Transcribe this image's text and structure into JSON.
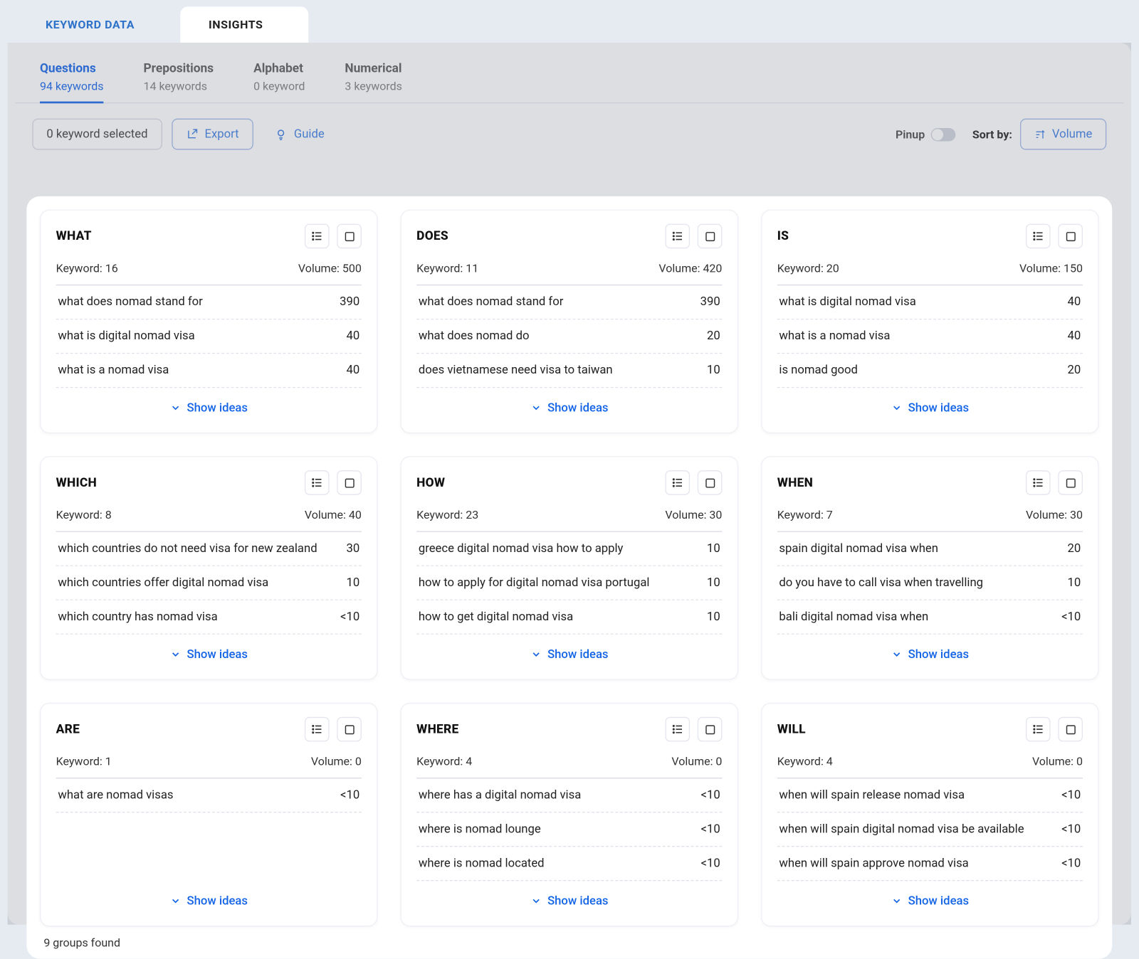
{
  "top_tabs": {
    "keyword_data": "KEYWORD DATA",
    "insights": "INSIGHTS"
  },
  "sub_tabs": [
    {
      "label": "Questions",
      "count": "94 keywords",
      "active": true
    },
    {
      "label": "Prepositions",
      "count": "14 keywords",
      "active": false
    },
    {
      "label": "Alphabet",
      "count": "0 keyword",
      "active": false
    },
    {
      "label": "Numerical",
      "count": "3 keywords",
      "active": false
    }
  ],
  "toolbar": {
    "selected": "0 keyword selected",
    "export": "Export",
    "guide": "Guide",
    "pinup": "Pinup",
    "sort_by": "Sort by:",
    "sort_value": "Volume"
  },
  "cards": [
    {
      "title": "WHAT",
      "keyword_count": "Keyword: 16",
      "volume": "Volume: 500",
      "rows": [
        {
          "kw": "what does nomad stand for",
          "vol": "390"
        },
        {
          "kw": "what is digital nomad visa",
          "vol": "40"
        },
        {
          "kw": "what is a nomad visa",
          "vol": "40"
        }
      ]
    },
    {
      "title": "DOES",
      "keyword_count": "Keyword: 11",
      "volume": "Volume: 420",
      "rows": [
        {
          "kw": "what does nomad stand for",
          "vol": "390"
        },
        {
          "kw": "what does nomad do",
          "vol": "20"
        },
        {
          "kw": "does vietnamese need visa to taiwan",
          "vol": "10"
        }
      ]
    },
    {
      "title": "IS",
      "keyword_count": "Keyword: 20",
      "volume": "Volume: 150",
      "rows": [
        {
          "kw": "what is digital nomad visa",
          "vol": "40"
        },
        {
          "kw": "what is a nomad visa",
          "vol": "40"
        },
        {
          "kw": "is nomad good",
          "vol": "20"
        }
      ]
    },
    {
      "title": "WHICH",
      "keyword_count": "Keyword: 8",
      "volume": "Volume: 40",
      "rows": [
        {
          "kw": "which countries do not need visa for new zealand",
          "vol": "30"
        },
        {
          "kw": "which countries offer digital nomad visa",
          "vol": "10"
        },
        {
          "kw": "which country has nomad visa",
          "vol": "<10"
        }
      ]
    },
    {
      "title": "HOW",
      "keyword_count": "Keyword: 23",
      "volume": "Volume: 30",
      "rows": [
        {
          "kw": "greece digital nomad visa how to apply",
          "vol": "10"
        },
        {
          "kw": "how to apply for digital nomad visa portugal",
          "vol": "10"
        },
        {
          "kw": "how to get digital nomad visa",
          "vol": "10"
        }
      ]
    },
    {
      "title": "WHEN",
      "keyword_count": "Keyword: 7",
      "volume": "Volume: 30",
      "rows": [
        {
          "kw": "spain digital nomad visa when",
          "vol": "20"
        },
        {
          "kw": "do you have to call visa when travelling",
          "vol": "10"
        },
        {
          "kw": "bali digital nomad visa when",
          "vol": "<10"
        }
      ]
    },
    {
      "title": "ARE",
      "keyword_count": "Keyword: 1",
      "volume": "Volume: 0",
      "rows": [
        {
          "kw": "what are nomad visas",
          "vol": "<10"
        }
      ]
    },
    {
      "title": "WHERE",
      "keyword_count": "Keyword: 4",
      "volume": "Volume: 0",
      "rows": [
        {
          "kw": "where has a digital nomad visa",
          "vol": "<10"
        },
        {
          "kw": "where is nomad lounge",
          "vol": "<10"
        },
        {
          "kw": "where is nomad located",
          "vol": "<10"
        }
      ]
    },
    {
      "title": "WILL",
      "keyword_count": "Keyword: 4",
      "volume": "Volume: 0",
      "rows": [
        {
          "kw": "when will spain release nomad visa",
          "vol": "<10"
        },
        {
          "kw": "when will spain digital nomad visa be available",
          "vol": "<10"
        },
        {
          "kw": "when will spain approve nomad visa",
          "vol": "<10"
        }
      ]
    }
  ],
  "show_ideas": "Show ideas",
  "footer": "9 groups found"
}
